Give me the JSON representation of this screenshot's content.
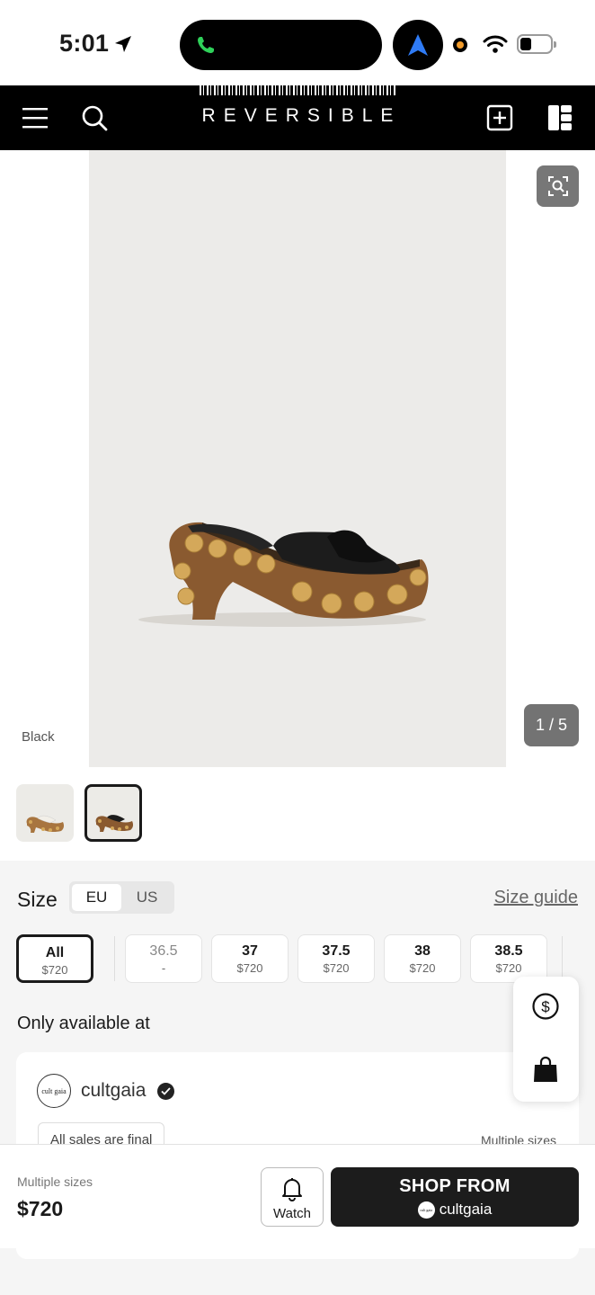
{
  "status_bar": {
    "time": "5:01"
  },
  "header": {
    "brand": "REVERSIBLE"
  },
  "gallery": {
    "counter": "1 / 5",
    "color_label": "Black",
    "current_index": 1,
    "total_images": 5
  },
  "size": {
    "title": "Size",
    "units": [
      "EU",
      "US"
    ],
    "active_unit": "EU",
    "guide_label": "Size guide",
    "options": [
      {
        "size": "All",
        "price": "$720",
        "selected": true
      },
      {
        "size": "36.5",
        "price": "-",
        "selected": false
      },
      {
        "size": "37",
        "price": "$720",
        "selected": false
      },
      {
        "size": "37.5",
        "price": "$720",
        "selected": false
      },
      {
        "size": "38",
        "price": "$720",
        "selected": false
      },
      {
        "size": "38.5",
        "price": "$720",
        "selected": false
      }
    ]
  },
  "availability": {
    "title": "Only available at",
    "retailer": {
      "name": "cultgaia",
      "logo_text": "cult gaia",
      "tag": "All sales are final",
      "sizes": "Multiple sizes"
    }
  },
  "bottom_bar": {
    "sizes_label": "Multiple sizes",
    "price": "$720",
    "watch_label": "Watch",
    "shop_label": "SHOP FROM",
    "shop_retailer": "cultgaia"
  },
  "colors": {
    "header_bg": "#000000",
    "accent_dark": "#1c1c1c",
    "image_bg": "#ecebe9"
  }
}
